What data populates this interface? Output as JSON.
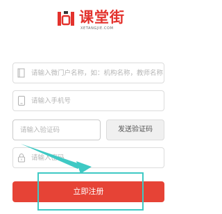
{
  "logo": {
    "name": "课堂街",
    "domain": "XETANGJIE.COM"
  },
  "form": {
    "name_placeholder": "请输入微门户名称，如：机构名称，教师名称",
    "phone_placeholder": "请输入手机号",
    "code_placeholder": "请输入验证码",
    "send_code_label": "发送验证码",
    "password_placeholder": "请输入密码",
    "register_label": "立即注册"
  },
  "colors": {
    "brand": "#e3322d",
    "register_button": "#e64336",
    "annotation": "#3ec9c4"
  },
  "icons": {
    "name_field": "document-icon",
    "phone_field": "phone-icon",
    "password_field": "lock-icon"
  }
}
